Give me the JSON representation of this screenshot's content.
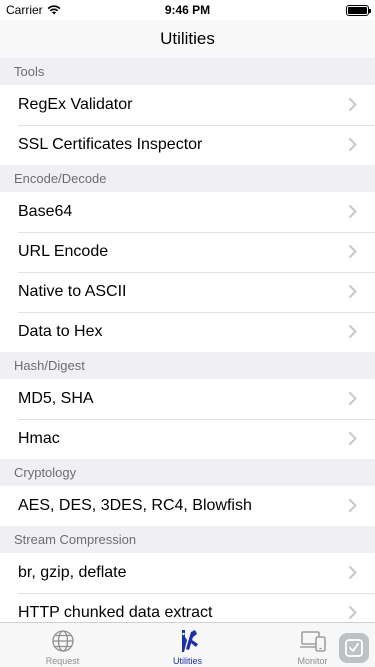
{
  "status_bar": {
    "carrier": "Carrier",
    "time": "9:46 PM"
  },
  "nav": {
    "title": "Utilities"
  },
  "sections": [
    {
      "header": "Tools",
      "items": [
        "RegEx Validator",
        "SSL Certificates Inspector"
      ]
    },
    {
      "header": "Encode/Decode",
      "items": [
        "Base64",
        "URL Encode",
        "Native to ASCII",
        "Data to Hex"
      ]
    },
    {
      "header": "Hash/Digest",
      "items": [
        "MD5, SHA",
        "Hmac"
      ]
    },
    {
      "header": "Cryptology",
      "items": [
        "AES, DES, 3DES, RC4, Blowfish"
      ]
    },
    {
      "header": "Stream Compression",
      "items": [
        "br, gzip, deflate",
        "HTTP chunked data extract"
      ]
    }
  ],
  "tabs": [
    {
      "label": "Request",
      "icon": "globe-icon",
      "active": false
    },
    {
      "label": "Utilities",
      "icon": "tools-icon",
      "active": true
    },
    {
      "label": "Monitor",
      "icon": "devices-icon",
      "active": false
    }
  ],
  "colors": {
    "accent": "#1b2fa8",
    "section_bg": "#efeff4",
    "chevron": "#c7c7cc"
  }
}
